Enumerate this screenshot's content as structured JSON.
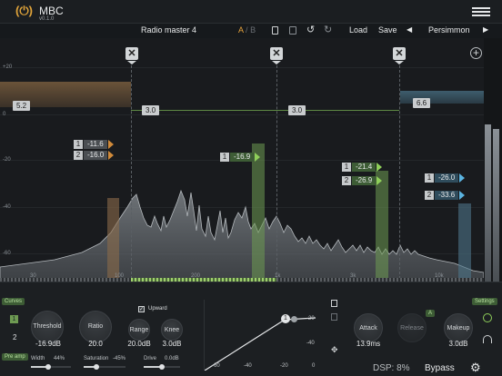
{
  "header": {
    "logo_glyph": "(⏻)",
    "title": "MBC",
    "version": "v0.1.0",
    "menu_icon": "hamburger-menu-icon"
  },
  "toolbar": {
    "preset_name": "Radio master 4",
    "ab_a": "A",
    "ab_sep": "/",
    "ab_b": "B",
    "load": "Load",
    "save": "Save",
    "preset_bank": "Persimmon",
    "icons": [
      "copy-icon",
      "paste-icon",
      "undo-icon",
      "redo-icon",
      "prev-arrow-icon",
      "next-arrow-icon"
    ]
  },
  "analyzer": {
    "y_labels": [
      "+20",
      "0",
      "-20",
      "-40",
      "-60"
    ],
    "x_labels": [
      "30",
      "100",
      "200",
      "1k",
      "3k",
      "10k"
    ],
    "add_band_glyph": "+",
    "crossover_glyph": "✕",
    "bands": [
      {
        "gain": "5.2",
        "color": "#8a6a4a"
      },
      {
        "gain": "3.0",
        "color": "#5e8a45"
      },
      {
        "gain": "3.0",
        "color": "#5e8a45"
      },
      {
        "gain": "6.6",
        "color": "#4d7488"
      }
    ],
    "thresholds": [
      {
        "rows": [
          {
            "n": "1",
            "v": "-11.6"
          },
          {
            "n": "2",
            "v": "-16.0"
          }
        ],
        "color": "#d08a3a"
      },
      {
        "rows": [
          {
            "n": "1",
            "v": "-16.9"
          }
        ],
        "color": "#8fcf5a"
      },
      {
        "rows": [
          {
            "n": "1",
            "v": "-21.4"
          },
          {
            "n": "2",
            "v": "-26.9"
          }
        ],
        "color": "#8fcf5a"
      },
      {
        "rows": [
          {
            "n": "1",
            "v": "-26.0"
          },
          {
            "n": "2",
            "v": "-33.6"
          }
        ],
        "color": "#5ab3e0"
      }
    ],
    "accent_colors": {
      "low": "#d08a3a",
      "mid": "#8fcf5a",
      "high": "#5ab3e0"
    }
  },
  "panel": {
    "curves_tag": "Curves",
    "settings_tag": "Settings",
    "pre_amp_tag": "Pre amp",
    "band_number": "1",
    "band_count": "2",
    "upward_label": "Upward",
    "upward_checked": true,
    "knobs": [
      {
        "label": "Threshold",
        "value": "-16.9dB"
      },
      {
        "label": "Ratio",
        "value": "20.0"
      },
      {
        "label": "Range",
        "value": "20.0dB"
      },
      {
        "label": "Knee",
        "value": "3.0dB"
      },
      {
        "label": "Attack",
        "value": "13.9ms"
      },
      {
        "label": "Release",
        "value": ""
      },
      {
        "label": "Makeup",
        "value": "3.0dB"
      }
    ],
    "auto_release_tag": "A",
    "sliders": [
      {
        "label": "Width",
        "value": "44%",
        "level": 0.44
      },
      {
        "label": "Saturation",
        "value": "-45%",
        "level": 0.3
      },
      {
        "label": "Drive",
        "value": "0.0dB",
        "level": 0.5
      }
    ],
    "curve_labels": {
      "y": [
        "-20",
        "-40"
      ],
      "x": [
        "-60",
        "-40",
        "-20",
        "0"
      ],
      "node": "1"
    },
    "dsp": "DSP: 8%",
    "bypass": "Bypass",
    "settings_icon": "gear-icon"
  }
}
